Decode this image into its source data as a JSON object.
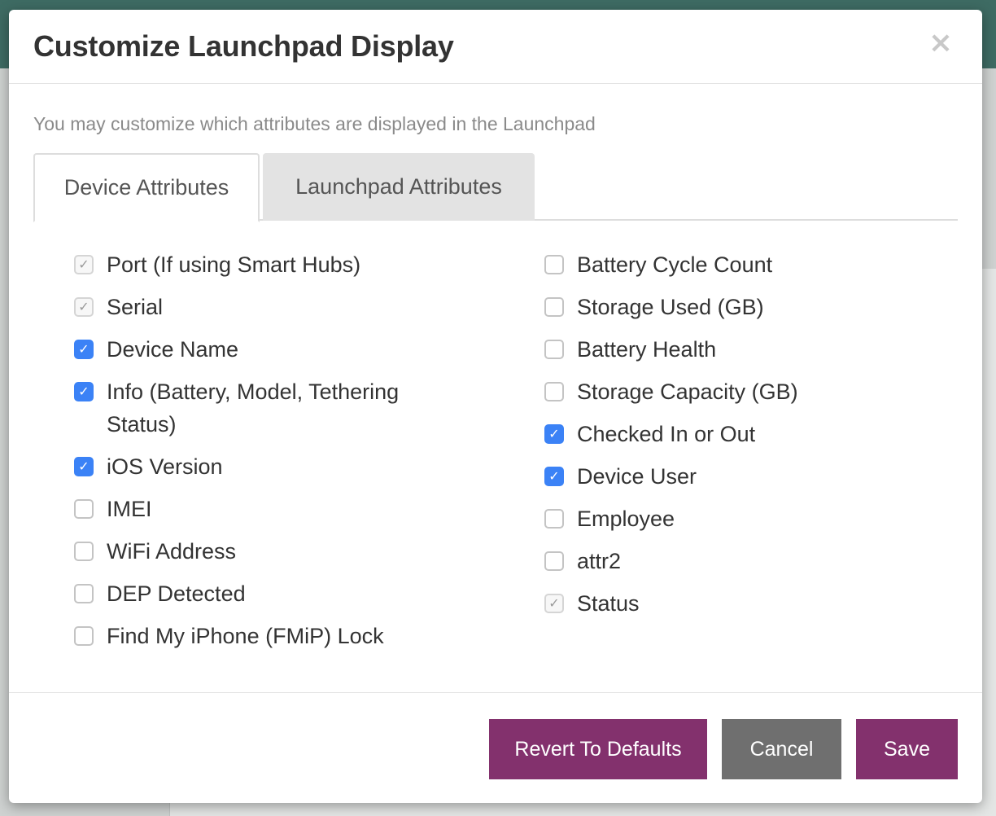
{
  "modal": {
    "title": "Customize Launchpad Display",
    "close_glyph": "×",
    "intro": "You may customize which attributes are displayed in the Launchpad"
  },
  "tabs": [
    {
      "label": "Device Attributes",
      "active": true
    },
    {
      "label": "Launchpad Attributes",
      "active": false
    }
  ],
  "device_attributes": {
    "left": [
      {
        "label": "Port (If using Smart Hubs)",
        "state": "locked"
      },
      {
        "label": "Serial",
        "state": "locked"
      },
      {
        "label": "Device Name",
        "state": "checked"
      },
      {
        "label": "Info (Battery, Model, Tethering Status)",
        "state": "checked"
      },
      {
        "label": "iOS Version",
        "state": "checked"
      },
      {
        "label": "IMEI",
        "state": "unchecked"
      },
      {
        "label": "WiFi Address",
        "state": "unchecked"
      },
      {
        "label": "DEP Detected",
        "state": "unchecked"
      },
      {
        "label": "Find My iPhone (FMiP) Lock",
        "state": "unchecked"
      }
    ],
    "right": [
      {
        "label": "Battery Cycle Count",
        "state": "unchecked"
      },
      {
        "label": "Storage Used (GB)",
        "state": "unchecked"
      },
      {
        "label": "Battery Health",
        "state": "unchecked"
      },
      {
        "label": "Storage Capacity (GB)",
        "state": "unchecked"
      },
      {
        "label": "Checked In or Out",
        "state": "checked"
      },
      {
        "label": "Device User",
        "state": "checked"
      },
      {
        "label": "Employee",
        "state": "unchecked"
      },
      {
        "label": "attr2",
        "state": "unchecked"
      },
      {
        "label": "Status",
        "state": "locked"
      }
    ]
  },
  "check_glyph": "✓",
  "footer": {
    "revert_label": "Revert To Defaults",
    "cancel_label": "Cancel",
    "save_label": "Save"
  },
  "colors": {
    "accent_purple": "#83316d",
    "checkbox_blue": "#3b82f6",
    "cancel_gray": "#6f6f6f",
    "header_teal": "#3e6b63"
  }
}
